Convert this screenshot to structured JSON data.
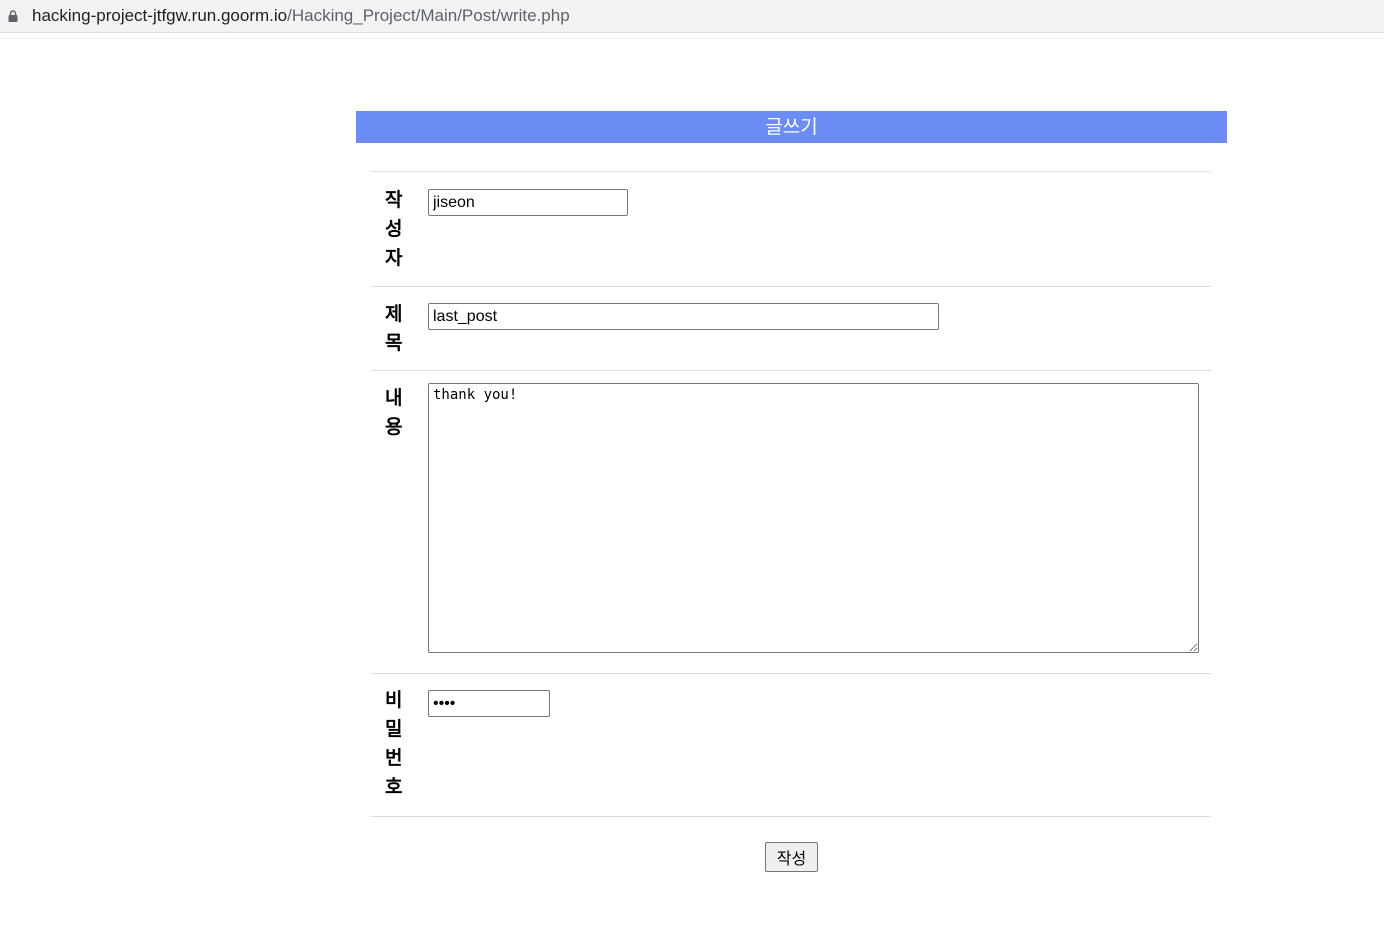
{
  "browser": {
    "url_host": "hacking-project-jtfgw.run.goorm.io",
    "url_path": "/Hacking_Project/Main/Post/write.php"
  },
  "page": {
    "header_title": "글쓰기"
  },
  "form": {
    "author_label": "작성자",
    "author_value": "jiseon",
    "title_label": "제목",
    "title_value": "last_post",
    "content_label": "내용",
    "content_value": "thank you!",
    "password_label": "비밀번호",
    "password_value": "1234",
    "submit_label": "작성"
  },
  "colors": {
    "header_bg": "#6c8cf5"
  }
}
